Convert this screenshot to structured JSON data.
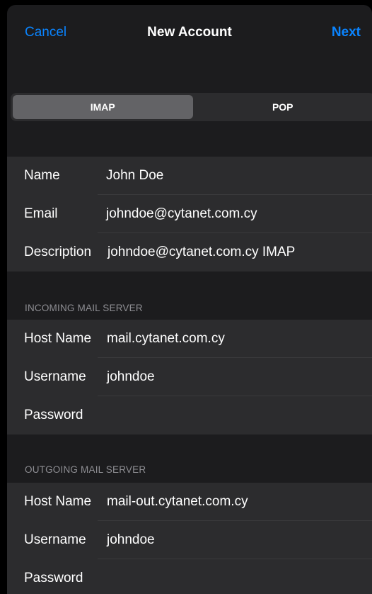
{
  "nav": {
    "cancel_label": "Cancel",
    "title": "New Account",
    "next_label": "Next"
  },
  "segmented": {
    "options": [
      "IMAP",
      "POP"
    ],
    "selected": "IMAP"
  },
  "account": {
    "name_label": "Name",
    "name_value": "John Doe",
    "email_label": "Email",
    "email_value": "johndoe@cytanet.com.cy",
    "description_label": "Description",
    "description_value": "johndoe@cytanet.com.cy IMAP"
  },
  "incoming": {
    "header": "INCOMING MAIL SERVER",
    "host_label": "Host Name",
    "host_value": "mail.cytanet.com.cy",
    "username_label": "Username",
    "username_value": "johndoe",
    "password_label": "Password",
    "password_value": ""
  },
  "outgoing": {
    "header": "OUTGOING MAIL SERVER",
    "host_label": "Host Name",
    "host_value": "mail-out.cytanet.com.cy",
    "username_label": "Username",
    "username_value": "johndoe",
    "password_label": "Password",
    "password_value": ""
  },
  "colors": {
    "accent": "#0a84ff",
    "background": "#1c1c1e",
    "cell": "#2c2c2e",
    "secondary_text": "#8e8e93"
  }
}
